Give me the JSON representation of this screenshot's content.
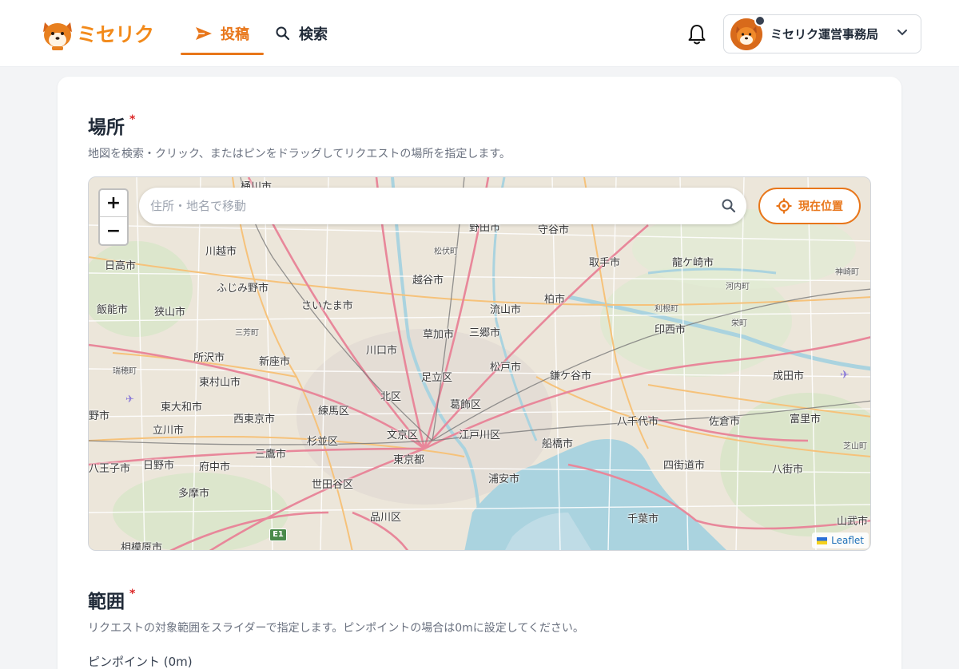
{
  "app": {
    "logo_text": "ミセリク"
  },
  "nav": {
    "post_label": "投稿",
    "search_label": "検索"
  },
  "user": {
    "name": "ミセリク運営事務局"
  },
  "location_section": {
    "title": "場所",
    "required_mark": "*",
    "description": "地図を検索・クリック、またはピンをドラッグしてリクエストの場所を指定します。"
  },
  "map": {
    "search_placeholder": "住所・地名で移動",
    "locate_label": "現在位置",
    "zoom_in": "+",
    "zoom_out": "−",
    "attribution": "Leaflet",
    "road_badge": "E1",
    "labels": [
      "ふじみ野市",
      "川越市",
      "さいたま市",
      "越谷市",
      "流山市",
      "柏市",
      "取手市",
      "龍ケ崎市",
      "草加市",
      "三郷市",
      "川口市",
      "印西市",
      "所沢市",
      "新座市",
      "松戸市",
      "足立区",
      "鎌ケ谷市",
      "成田市",
      "東村山市",
      "北区",
      "葛飾区",
      "東大和市",
      "練馬区",
      "西東京市",
      "八千代市",
      "佐倉市",
      "富里市",
      "立川市",
      "文京区",
      "江戸川区",
      "杉並区",
      "船橋市",
      "日野市",
      "府中市",
      "三鷹市",
      "東京都",
      "四街道市",
      "八街市",
      "浦安市",
      "多摩市",
      "世田谷区",
      "品川区",
      "千葉市",
      "山武市",
      "日高市",
      "飯能市",
      "狭山市",
      "相模原市",
      "野田市",
      "守谷市",
      "桶川市",
      "八王子市",
      "野市",
      "瑞穂町",
      "三芳町",
      "松伏町",
      "河内町",
      "利根町",
      "栄町",
      "神崎町",
      "芝山町"
    ]
  },
  "range_section": {
    "title": "範囲",
    "required_mark": "*",
    "description": "リクエストの対象範囲をスライダーで指定します。ピンポイントの場合は0mに設定してください。",
    "current_value": "ピンポイント (0m)"
  }
}
